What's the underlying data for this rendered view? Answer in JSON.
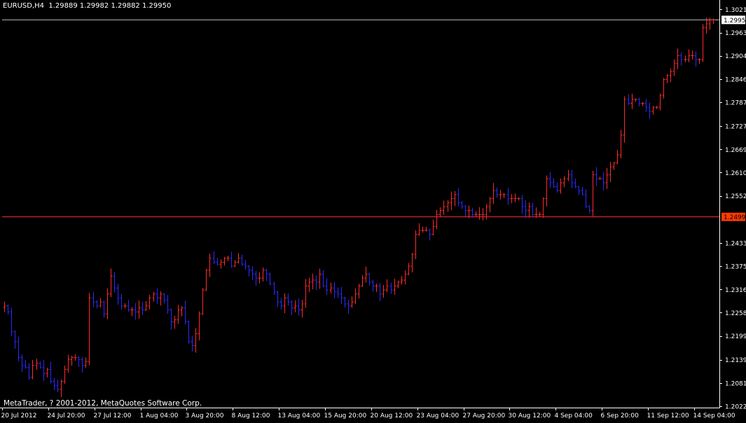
{
  "header": {
    "symbol": "EURUSD,H4",
    "ohlc": "1.29889 1.29982 1.29882 1.29950"
  },
  "copyright": "MetaTrader, ? 2001-2012, MetaQuotes Software Corp.",
  "colors": {
    "background": "#000000",
    "axis": "#ffffff",
    "bull": "#ff2a2a",
    "bear": "#2a2aff",
    "bid_line": "#b8b8b8",
    "horizontal_line": "#ff3030",
    "horizontal_label_bg": "#ff3b00",
    "bid_label_bg": "#ffffff"
  },
  "chart_data": {
    "type": "bar",
    "title": "EURUSD,H4",
    "x_tick_labels": [
      "20 Jul 2012",
      "24 Jul 20:00",
      "27 Jul 12:00",
      "1 Aug 04:00",
      "3 Aug 20:00",
      "8 Aug 12:00",
      "13 Aug 04:00",
      "15 Aug 20:00",
      "20 Aug 12:00",
      "23 Aug 04:00",
      "27 Aug 20:00",
      "30 Aug 12:00",
      "4 Sep 04:00",
      "6 Sep 20:00",
      "11 Sep 12:00",
      "14 Sep 04:00"
    ],
    "y_tick_labels": [
      "1.30215",
      "1.29630",
      "1.29045",
      "1.28460",
      "1.27875",
      "1.27275",
      "1.26690",
      "1.26105",
      "1.25520",
      "1.24335",
      "1.23750",
      "1.23165",
      "1.22580",
      "1.21995",
      "1.21395",
      "1.20810",
      "1.20225"
    ],
    "ylim": [
      1.2019,
      1.3038
    ],
    "bid_price": "1.29950",
    "horizontal_line_price": "1.24991",
    "grid": false,
    "price_path": [
      [
        1.2275,
        1.226,
        1.221,
        1.2185,
        1.2145,
        1.2125,
        1.212,
        1.2095,
        1.2125,
        1.213,
        1.212,
        1.2105,
        1.2115,
        1.2085,
        1.2075,
        1.2065
      ],
      [
        1.2085,
        1.2115,
        1.214,
        1.2145,
        1.2145,
        1.214,
        1.2125,
        1.2135,
        1.2295,
        1.2285,
        1.2275,
        1.2285,
        1.2255,
        1.2305,
        1.235,
        1.232
      ],
      [
        1.2295,
        1.2275,
        1.2275,
        1.2265,
        1.2265,
        1.226,
        1.227,
        1.2265,
        1.2275,
        1.2295,
        1.2305,
        1.2295,
        1.2305,
        1.229,
        1.2265,
        1.2235
      ],
      [
        1.224,
        1.2265,
        1.227,
        1.2235,
        1.2185,
        1.2175,
        1.2205,
        1.2255,
        1.2315,
        1.2365,
        1.2395,
        1.2385,
        1.238,
        1.2385,
        1.2395,
        1.2395
      ],
      [
        1.2375,
        1.2385,
        1.2395,
        1.238,
        1.2375,
        1.2365,
        1.2355,
        1.2345,
        1.2345,
        1.2365,
        1.2355,
        1.233,
        1.231,
        1.2285,
        1.2275,
        1.2295
      ],
      [
        1.2285,
        1.227,
        1.2275,
        1.2265,
        1.228,
        1.2325,
        1.2335,
        1.234,
        1.2335,
        1.2355,
        1.2325,
        1.2315,
        1.232,
        1.231,
        1.2305,
        1.2295
      ],
      [
        1.228,
        1.2275,
        1.2285,
        1.2305,
        1.2325,
        1.2345,
        1.2355,
        1.2335,
        1.2325,
        1.2325,
        1.2305,
        1.2315,
        1.2325,
        1.2315,
        1.2325,
        1.2335
      ],
      [
        1.234,
        1.2355,
        1.2375,
        1.2405,
        1.2455,
        1.2465,
        1.2465,
        1.2465,
        1.2455,
        1.2475,
        1.2505,
        1.2515,
        1.2525,
        1.2535,
        1.2545,
        1.2555
      ],
      [
        1.2535,
        1.2525,
        1.2515,
        1.2515,
        1.2505,
        1.2505,
        1.2505,
        1.2505,
        1.2525,
        1.2545,
        1.2565,
        1.2555,
        1.2555,
        1.2555,
        1.2545,
        1.2545
      ],
      [
        1.2545,
        1.2545,
        1.2525,
        1.2515,
        1.2525,
        1.2505,
        1.2505,
        1.2505,
        1.2545,
        1.2595,
        1.2585,
        1.2575,
        1.2565,
        1.2585,
        1.2595,
        1.2605
      ],
      [
        1.2585,
        1.2575,
        1.2565,
        1.2555,
        1.2525,
        1.2515,
        1.2605,
        1.2595,
        1.2595,
        1.2585,
        1.2605,
        1.2625,
        1.2635,
        1.2655,
        1.2705,
        1.2795
      ],
      [
        1.2785,
        1.2795,
        1.2795,
        1.2785,
        1.2785,
        1.2775,
        1.2765,
        1.2775,
        1.2775,
        1.2805,
        1.2845,
        1.2855,
        1.2865,
        1.2885,
        1.2905,
        1.2895
      ],
      [
        1.2895,
        1.2905,
        1.2905,
        1.2895,
        1.2895,
        1.2975,
        1.2985,
        1.2995,
        1.2995
      ]
    ]
  }
}
